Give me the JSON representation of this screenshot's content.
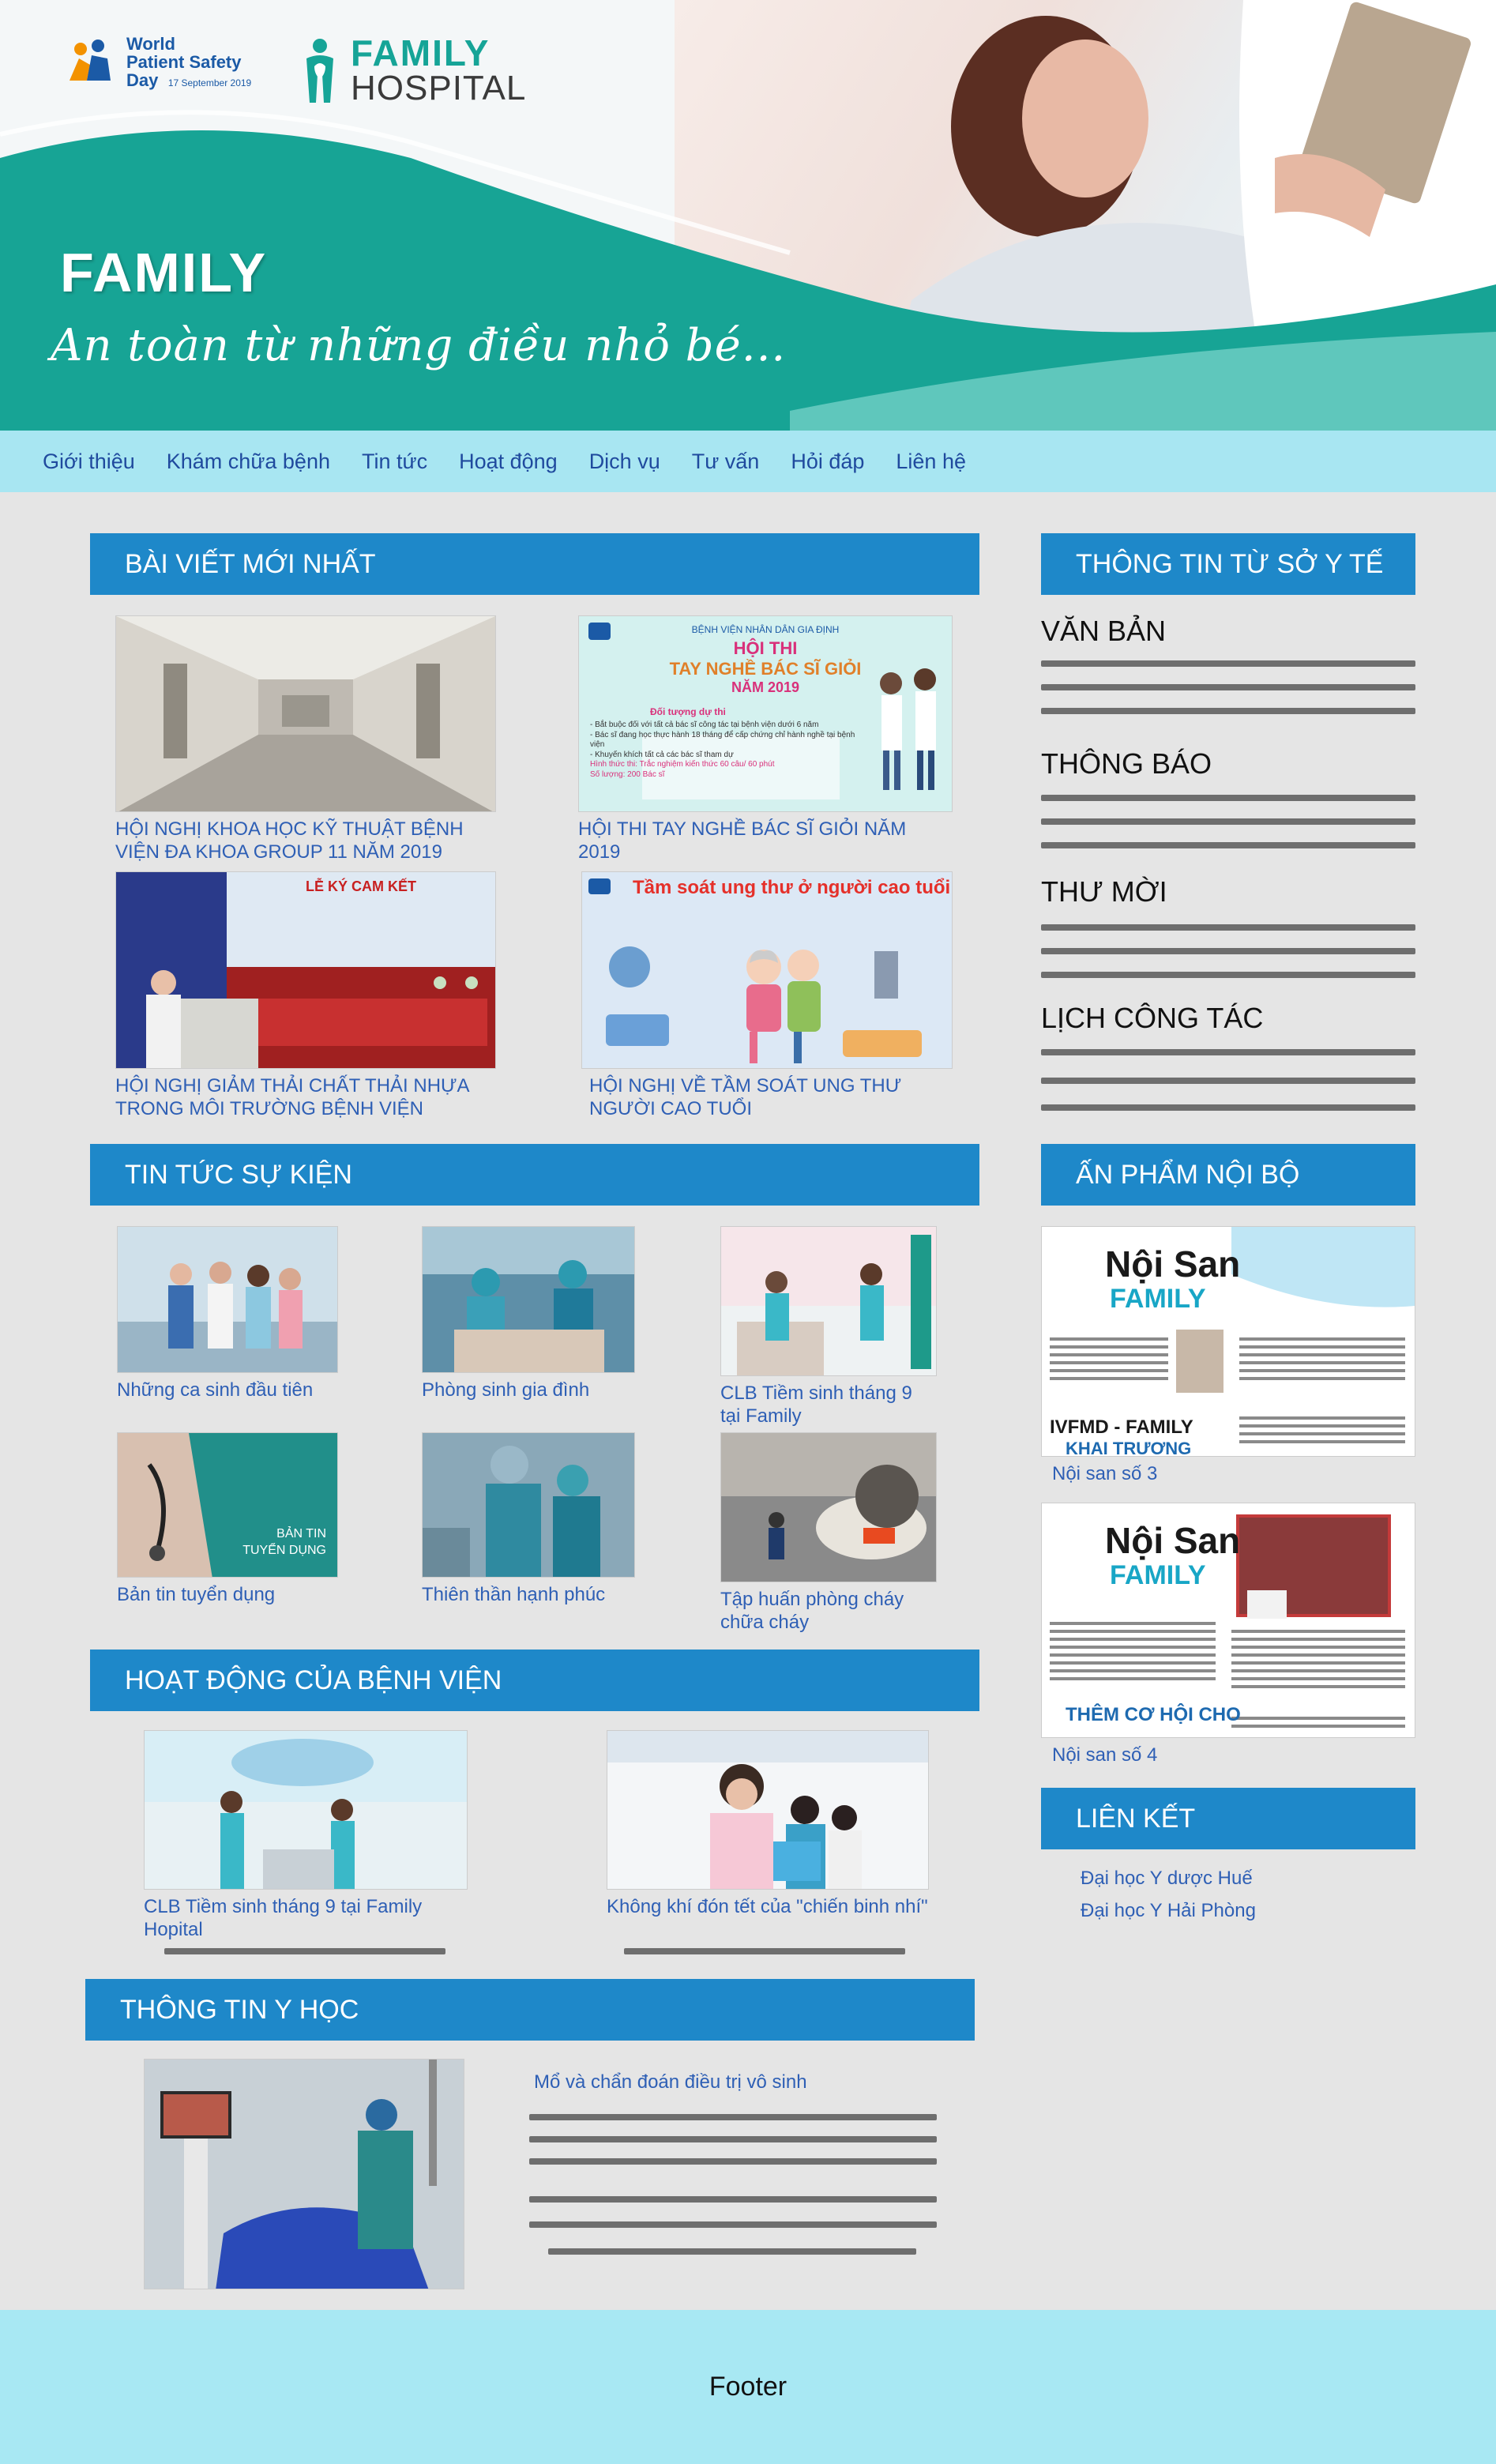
{
  "header": {
    "wpsd_line1": "World",
    "wpsd_line2": "Patient Safety",
    "wpsd_line3": "Day",
    "wpsd_date": "17 September 2019",
    "brand_line1": "FAMILY",
    "brand_line2": "HOSPITAL",
    "hero_title": "FAMILY",
    "hero_slogan": "An toàn từ những điều nhỏ bé..."
  },
  "nav": [
    "Giới thiệu",
    "Khám chữa bệnh",
    "Tin tức",
    "Hoạt động",
    "Dịch vụ",
    "Tư vấn",
    "Hỏi đáp",
    "Liên hệ"
  ],
  "latest": {
    "title": "BÀI VIẾT MỚI NHẤT",
    "items": [
      {
        "caption": "HỘI NGHỊ KHOA HỌC KỸ THUẬT BỆNH VIỆN ĐA KHOA GROUP 11 NĂM 2019"
      },
      {
        "caption": "HỘI THI TAY NGHỀ BÁC SĨ GIỎI NĂM 2019",
        "poster_l1": "BỆNH VIỆN NHÂN DÂN GIA ĐỊNH",
        "poster_l2": "HỘI THI",
        "poster_l3": "TAY NGHỀ BÁC SĨ GIỎI",
        "poster_l4": "NĂM 2019",
        "poster_l5": "Đối tượng dự thi",
        "poster_l6": "- Bắt buộc đối với tất cả bác sĩ công tác tại bệnh viện dưới 6 năm",
        "poster_l7": "- Bác sĩ đang học thực hành 18 tháng để cấp chứng chỉ hành nghề tại bệnh viện",
        "poster_l8": "- Khuyến khích tất cả các bác sĩ tham dự",
        "poster_l9": "Hình thức thi: Trắc nghiệm kiến thức 60 câu/ 60 phút",
        "poster_l10": "Số lượng: 200 Bác sĩ"
      },
      {
        "caption": "HỘI NGHỊ GIẢM THẢI CHẤT THẢI NHỰA TRONG MÔI TRƯỜNG BỆNH VIỆN",
        "banner": "LỄ KÝ CAM KẾT"
      },
      {
        "caption": "HỘI NGHỊ VỀ TẦM SOÁT UNG THƯ NGƯỜI CAO TUỔI",
        "poster_title": "Tầm soát ung thư ở người cao tuổi"
      }
    ]
  },
  "news": {
    "title": "TIN TỨC SỰ KIỆN",
    "items": [
      {
        "caption": "Những ca sinh đầu tiên"
      },
      {
        "caption": "Phòng sinh gia đình"
      },
      {
        "caption": "CLB Tiềm sinh tháng 9 tại Family"
      },
      {
        "caption": "Bản tin tuyển dụng",
        "img_text1": "BẢN TIN",
        "img_text2": "TUYỂN DỤNG"
      },
      {
        "caption": "Thiên thần hạnh phúc"
      },
      {
        "caption": "Tập huấn phòng cháy chữa cháy"
      }
    ]
  },
  "activities": {
    "title": "HOẠT ĐỘNG CỦA BỆNH VIỆN",
    "items": [
      {
        "caption": "CLB Tiềm sinh tháng 9 tại Family Hopital"
      },
      {
        "caption": "Không khí đón tết của \"chiến binh nhí\""
      }
    ]
  },
  "medical": {
    "title": "THÔNG TIN Y HỌC",
    "article_title": "Mổ và chẩn đoán điều trị vô sinh"
  },
  "sidebar": {
    "info_title": "THÔNG TIN TỪ SỞ Y TẾ",
    "groups": [
      "VĂN BẢN",
      "THÔNG BÁO",
      "THƯ MỜI",
      "LỊCH CÔNG TÁC"
    ],
    "publications_title": "ẤN PHẨM NỘI BỘ",
    "publications": [
      {
        "caption": "Nội san số 3",
        "cover_title": "Nội San",
        "cover_brand": "FAMILY",
        "cover_sub": "IVFMD - FAMILY",
        "cover_sub2": "KHAI TRƯƠNG"
      },
      {
        "caption": "Nội san số 4",
        "cover_title": "Nội San",
        "cover_brand": "FAMILY",
        "cover_sub": "THÊM CƠ HỘI CHO"
      }
    ],
    "links_title": "LIÊN KẾT",
    "links": [
      "Đại học Y dược Huế",
      "Đại học Y Hải Phòng"
    ]
  },
  "footer": {
    "label": "Footer"
  },
  "colors": {
    "nav_bg": "#a8e6f2",
    "section_bg": "#1e88c9",
    "teal": "#16a497",
    "link": "#2e5fb5",
    "footer_bg": "#a8e8f3"
  }
}
